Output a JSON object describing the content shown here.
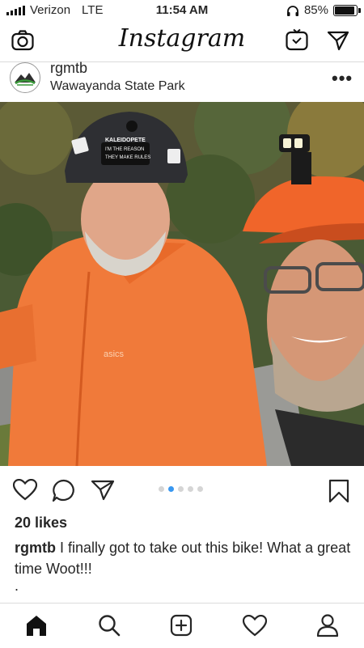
{
  "status_bar": {
    "carrier": "Verizon",
    "network": "LTE",
    "time": "11:54 AM",
    "battery_percent": "85%",
    "battery_level": 0.85
  },
  "top_nav": {
    "brand": "Instagram",
    "icons": [
      "camera-icon",
      "igtv-icon",
      "direct-message-icon"
    ]
  },
  "post": {
    "username": "rgmtb",
    "location": "Wawayanda State Park",
    "more_icon": "ellipsis-icon",
    "carousel": {
      "count": 5,
      "active_index": 1
    },
    "likes": "20 likes",
    "caption_username": "rgmtb",
    "caption_text": " I finally got to take out this bike! What a great time Woot!!!",
    "caption_extra": "."
  },
  "photo_text": {
    "helmet_line1": "KALEIDOPETE",
    "helmet_line2": "I'M THE REASON",
    "helmet_line3": "THEY MAKE RULES",
    "jacket_brand": "asics"
  },
  "bottom_nav": {
    "icons": [
      "home-icon",
      "search-icon",
      "new-post-icon",
      "activity-icon",
      "profile-icon"
    ]
  },
  "colors": {
    "accent_blue": "#3897f0",
    "jacket_orange": "#f07a3a",
    "helmet_orange": "#f0652a"
  }
}
